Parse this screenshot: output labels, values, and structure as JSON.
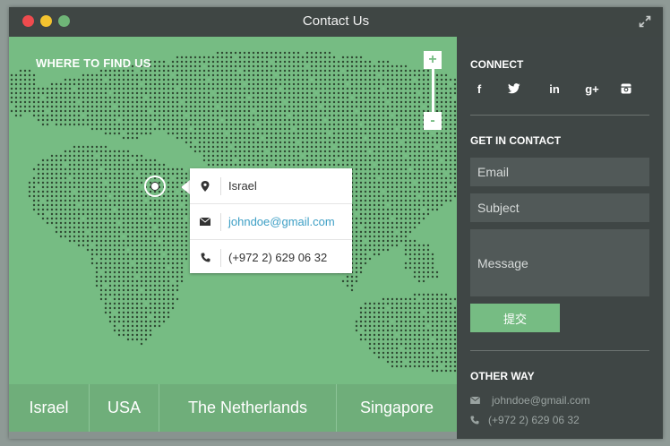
{
  "window": {
    "title": "Contact Us"
  },
  "map": {
    "heading": "WHERE TO FIND US",
    "zoom_in": "+",
    "zoom_out": "-",
    "popup": {
      "country": "Israel",
      "email": "johndoe@gmail.com",
      "phone": "(+972 2) 629 06 32"
    },
    "tabs": [
      "Israel",
      "USA",
      "The Netherlands",
      "Singapore"
    ]
  },
  "sidebar": {
    "connect_heading": "CONNECT",
    "social": [
      {
        "glyph": "f",
        "icon": "facebook-icon"
      },
      {
        "glyph": "",
        "icon": "twitter-icon"
      },
      {
        "glyph": "in",
        "icon": "linkedin-icon"
      },
      {
        "glyph": "g+",
        "icon": "google-plus-icon"
      },
      {
        "glyph": "",
        "icon": "instagram-icon"
      }
    ],
    "contact_heading": "GET IN CONTACT",
    "email_placeholder": "Email",
    "subject_placeholder": "Subject",
    "message_placeholder": "Message",
    "submit_label": "提交",
    "other_heading": "OTHER WAY",
    "other_email": "johndoe@gmail.com",
    "other_phone": "(+972 2) 629 06 32"
  },
  "colors": {
    "map_green": "#76bc83",
    "sidebar_dark": "#3f4645",
    "accent_blue": "#3d9fc5"
  }
}
